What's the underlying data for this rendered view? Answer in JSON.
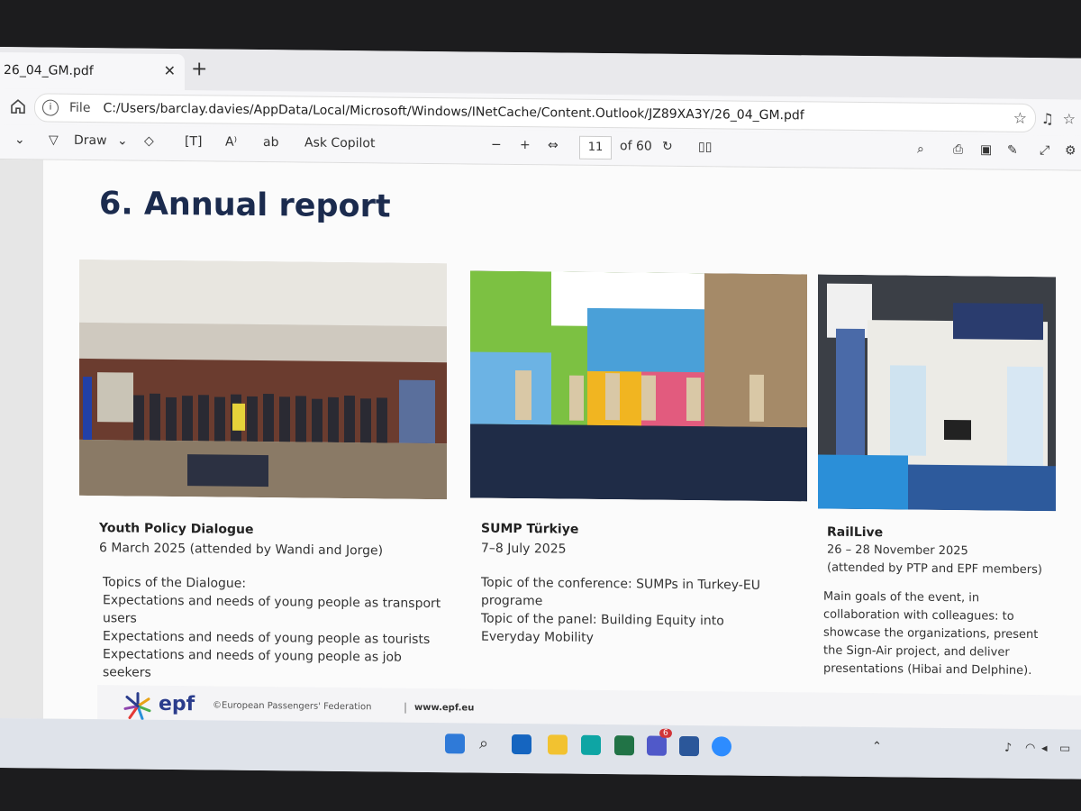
{
  "browser": {
    "tab_title": "26_04_GM.pdf",
    "tab_close": "✕",
    "new_tab": "+",
    "address_scheme": "File",
    "address_url": "C:/Users/barclay.davies/AppData/Local/Microsoft/Windows/INetCache/Content.Outlook/JZ89XA3Y/26_04_GM.pdf"
  },
  "pdf_toolbar": {
    "draw_label": "Draw",
    "ask_copilot_label": "Ask Copilot",
    "zoom_out": "−",
    "zoom_in": "+",
    "current_page": "11",
    "page_total": "of 60"
  },
  "page": {
    "heading": "6. Annual report",
    "columns": [
      {
        "title": "Youth Policy Dialogue",
        "date": "6 March 2025 (attended by Wandi and Jorge)",
        "body": "Topics of the Dialogue:\nExpectations and needs of young people as transport users\nExpectations and needs of young people as tourists\nExpectations and needs of young people as job seekers"
      },
      {
        "title": "SUMP Türkiye",
        "date": "7–8 July 2025",
        "body": "Topic of the conference: SUMPs in Turkey-EU programe\nTopic of the panel: Building Equity into Everyday Mobility"
      },
      {
        "title": "RailLive",
        "date": "26 – 28 November 2025\n(attended by PTP and EPF members)",
        "body": "Main goals of the event, in collaboration with colleagues: to showcase the organizations, present the Sign-Air project, and deliver presentations (Hibai and Delphine)."
      }
    ],
    "footer": {
      "logo_word": "epf",
      "org": "©European Passengers' Federation",
      "separator": "|",
      "url": "www.epf.eu"
    }
  },
  "taskbar": {
    "teams_badge": "6"
  },
  "colors": {
    "heading": "#1b2b4e",
    "epf_blue": "#2a3c8c"
  }
}
